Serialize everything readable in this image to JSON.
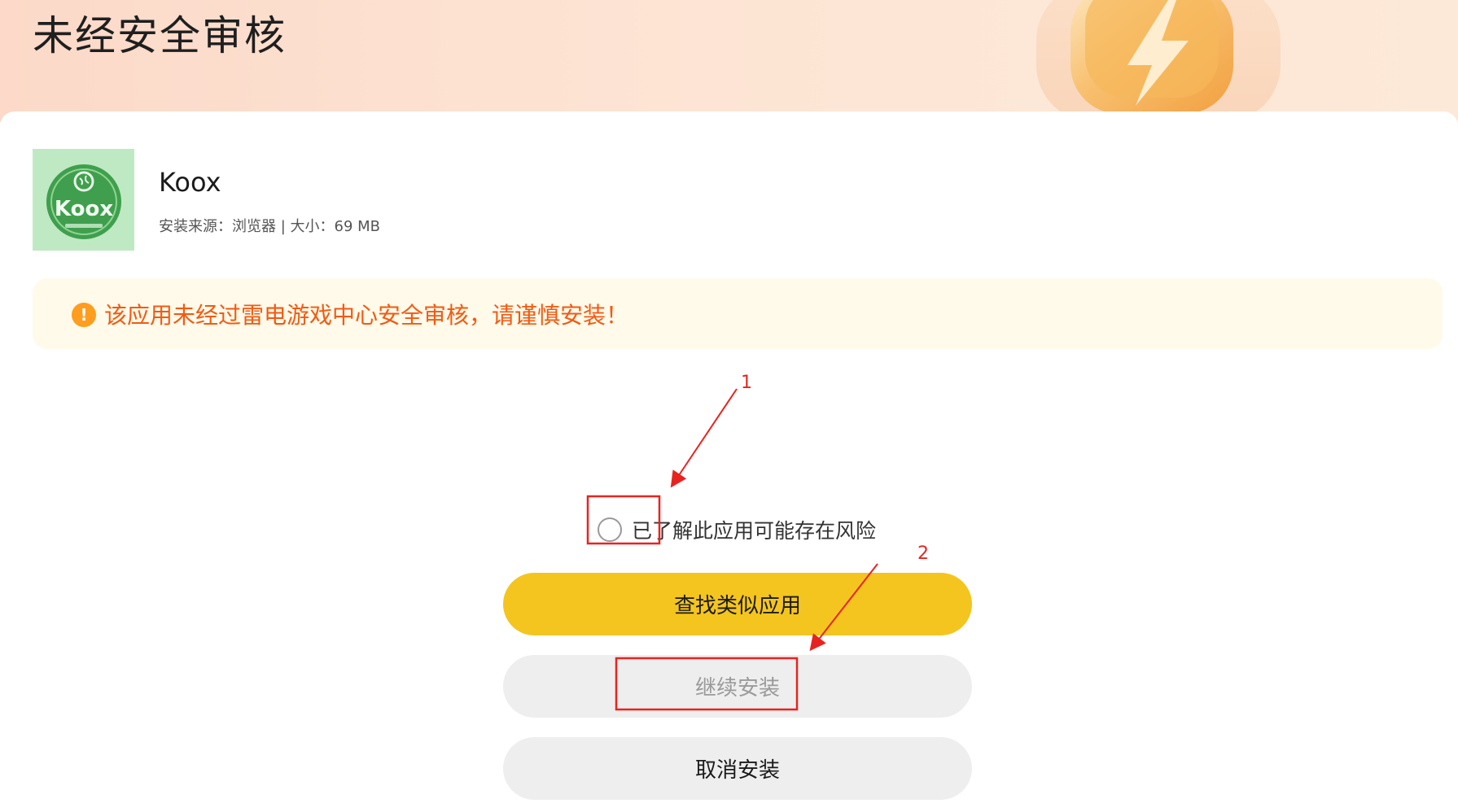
{
  "header": {
    "title": "未经安全审核"
  },
  "app": {
    "name": "Koox",
    "icon_label": "Koox",
    "meta": "安装来源：浏览器 | 大小：69 MB"
  },
  "warning": {
    "icon": "!",
    "text": "该应用未经过雷电游戏中心安全审核，请谨慎安装！"
  },
  "agree": {
    "label": "已了解此应用可能存在风险"
  },
  "buttons": {
    "find_similar": "查找类似应用",
    "continue_install": "继续安装",
    "cancel_install": "取消安装"
  },
  "annotations": {
    "marker_1": "1",
    "marker_2": "2"
  },
  "colors": {
    "accent_yellow": "#f4c51e",
    "warning_orange": "#f25a12",
    "annotation_red": "#e8231f"
  }
}
